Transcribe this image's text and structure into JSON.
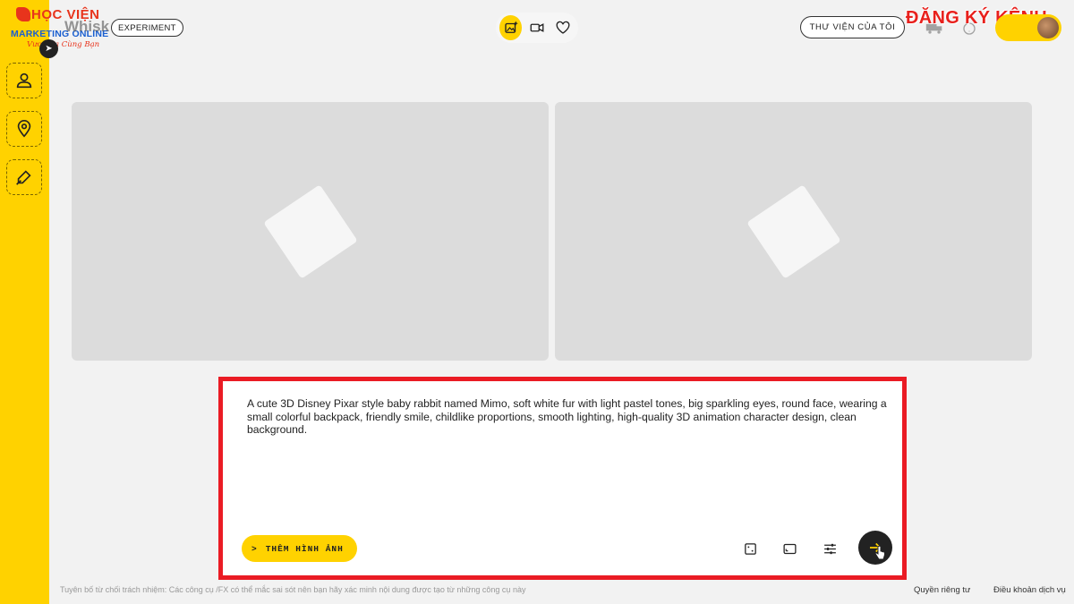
{
  "logo": {
    "line1": "HỌC VIỆN",
    "line2": "MARKETING ONLINE",
    "line3": "Vươn Xa Cùng Bạn"
  },
  "app": {
    "name": "Whisk",
    "badge": "EXPERIMENT"
  },
  "sidebar": {
    "items": [
      {
        "name": "subject",
        "icon": "person-icon"
      },
      {
        "name": "scene",
        "icon": "location-pin-icon"
      },
      {
        "name": "style",
        "icon": "brush-icon"
      }
    ],
    "expand_icon": "chevron-right-icon"
  },
  "mode_switch": {
    "items": [
      {
        "icon": "image-sparkle-icon",
        "active": true
      },
      {
        "icon": "video-swap-icon",
        "active": false
      },
      {
        "icon": "heart-icon",
        "active": false
      }
    ]
  },
  "header": {
    "library_label": "THƯ VIỆN CỦA TÔI",
    "subscribe_banner": "ĐĂNG KÝ KÊNH"
  },
  "prompt": {
    "text": "A cute 3D Disney Pixar style baby rabbit named Mimo, soft white fur with light pastel tones, big sparkling eyes, round face, wearing a small colorful backpack, friendly smile, childlike proportions, smooth lighting, high-quality 3D animation character design, clean background.",
    "add_image_label": "THÊM HÌNH ẢNH",
    "tools": [
      "dice-icon",
      "aspect-ratio-icon",
      "settings-sliders-icon"
    ],
    "send_icon": "arrow-right-icon"
  },
  "footer": {
    "disclaimer": "Tuyên bố từ chối trách nhiệm: Các công cụ /FX có thể mắc sai sót nên bạn hãy xác minh nội dung được tạo từ những công cụ này",
    "privacy": "Quyền riêng tư",
    "terms": "Điều khoản dịch vụ"
  },
  "colors": {
    "accent_yellow": "#ffd200",
    "highlight_red": "#ea1b24",
    "placeholder_gray": "#dcdcdc"
  }
}
